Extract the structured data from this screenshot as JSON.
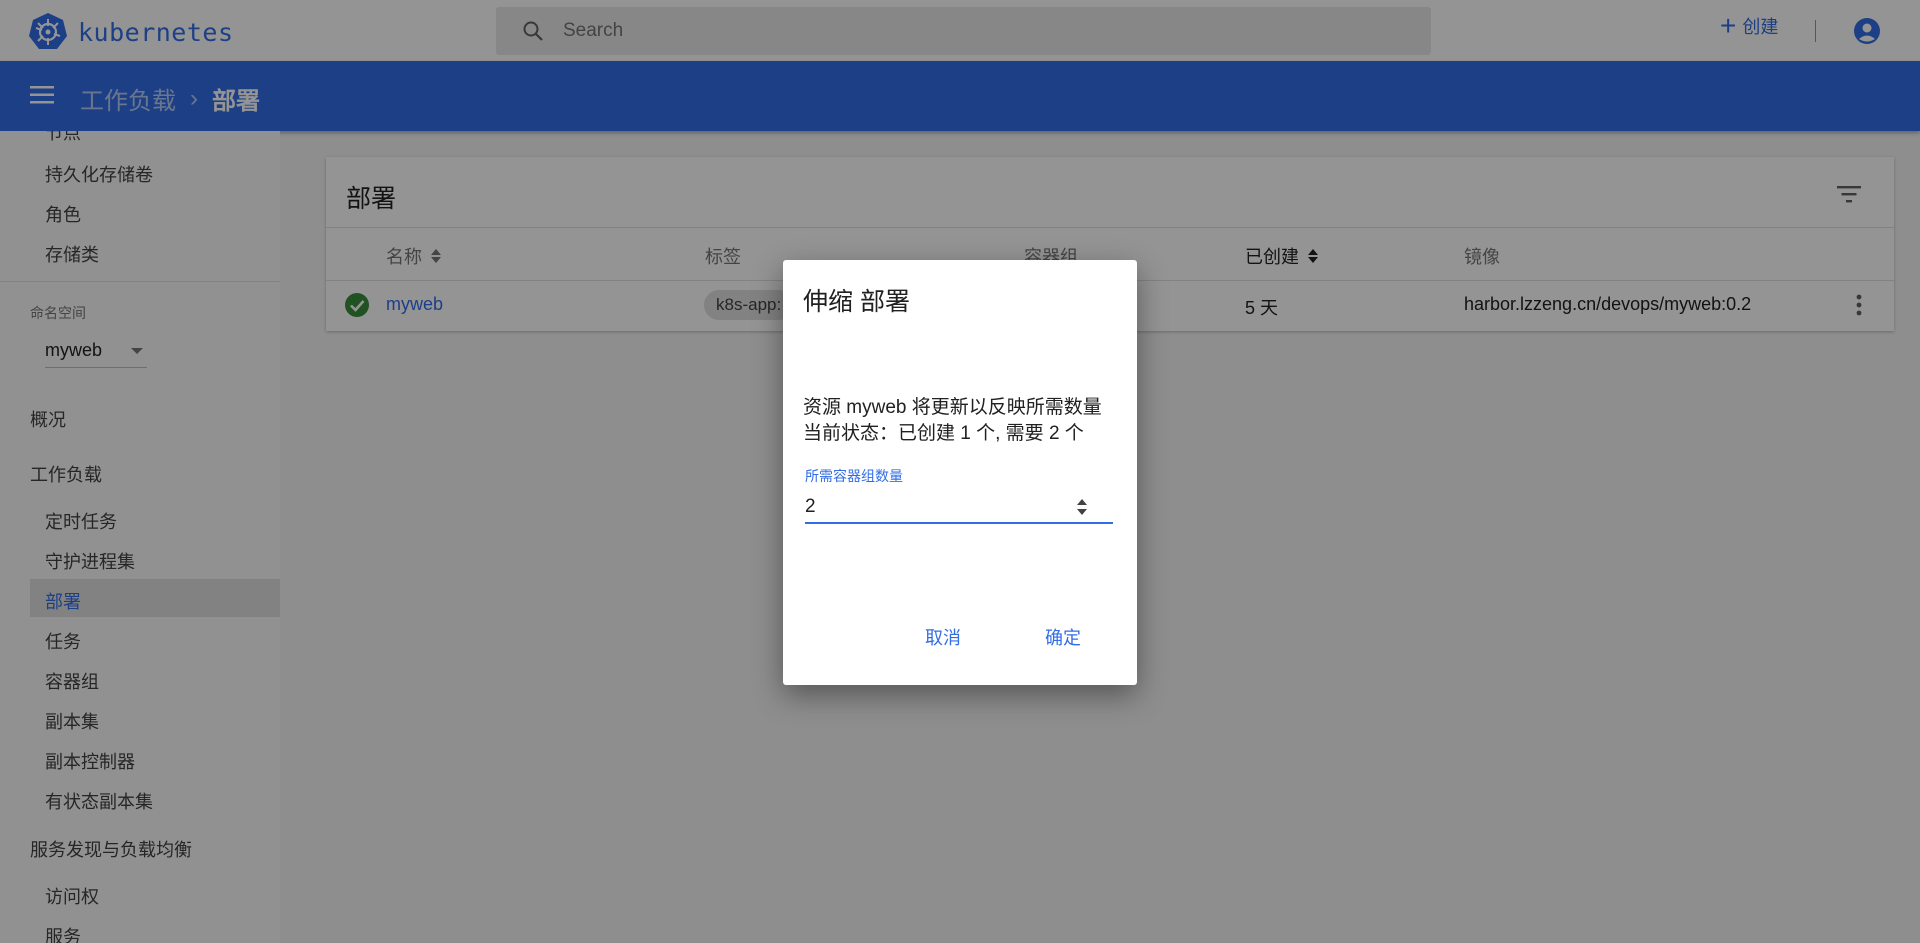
{
  "topbar": {
    "logo_text": "kubernetes",
    "search_placeholder": "Search",
    "create_label": "创建"
  },
  "breadcrumb": {
    "parent": "工作负载",
    "separator": "›",
    "current": "部署"
  },
  "sidebar": {
    "cluster_items": [
      "节点",
      "持久化存储卷",
      "角色",
      "存储类"
    ],
    "namespace_label": "命名空间",
    "namespace_value": "myweb",
    "overview": "概况",
    "workloads_section": "工作负载",
    "workload_items": [
      "定时任务",
      "守护进程集",
      "部署",
      "任务",
      "容器组",
      "副本集",
      "副本控制器",
      "有状态副本集"
    ],
    "active_item": "部署",
    "discovery_section": "服务发现与负载均衡",
    "discovery_items": [
      "访问权",
      "服务"
    ]
  },
  "card": {
    "title": "部署",
    "columns": {
      "name": "名称",
      "labels": "标签",
      "pods": "容器组",
      "created": "已创建",
      "images": "镜像"
    },
    "rows": [
      {
        "status": "success",
        "name": "myweb",
        "label_chip": "k8s-app:",
        "created": "5 天",
        "image": "harbor.lzzeng.cn/devops/myweb:0.2"
      }
    ]
  },
  "dialog": {
    "title": "伸缩 部署",
    "line1": "资源 myweb 将更新以反映所需数量",
    "line2": "当前状态：已创建 1 个, 需要 2 个",
    "field_label": "所需容器组数量",
    "field_value": "2",
    "cancel_label": "取消",
    "confirm_label": "确定"
  },
  "colors": {
    "primary": "#326de6",
    "success": "#388e3c"
  }
}
